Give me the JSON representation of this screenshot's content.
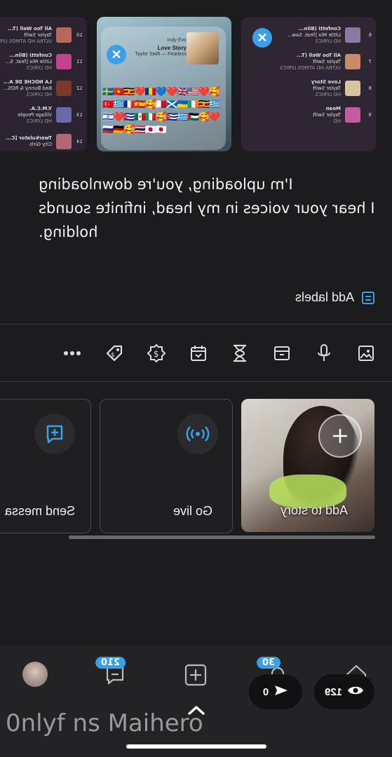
{
  "thumbnails": {
    "left_tracks": [
      {
        "num": "10",
        "title": "All Too Well (T...",
        "artist": "Taylor Swift",
        "tags": "ULTRA HD  ATMOS  LYRICS"
      },
      {
        "num": "11",
        "title": "Confetti (Blin...",
        "artist": "Little Mix [feat. S...",
        "tags": "HD  LYRICS"
      },
      {
        "num": "12",
        "title": "LA NOCHE DE A...",
        "artist": "Bad Bunny & ROS...",
        "tags": "HD  LYRICS"
      },
      {
        "num": "13",
        "title": "Y.M.C.A.",
        "artist": "Village People",
        "tags": "HD  LYRICS"
      },
      {
        "num": "14",
        "title": "Twerkulator [C...",
        "artist": "City Girls",
        "tags": ""
      }
    ],
    "middle": {
      "app": "Indy Evo",
      "song": "Love Story",
      "artist": "Taylor Swift — Fearless"
    },
    "right_tracks": [
      {
        "num": "6",
        "title": "Confetti (Blin...",
        "artist": "Little Mix [feat. Saw...",
        "tags": "HD  LYRICS"
      },
      {
        "num": "7",
        "title": "All Too Well (T...",
        "artist": "Taylor Swift",
        "tags": "ULTRA HD  ATMOS  LYRICS"
      },
      {
        "num": "8",
        "title": "Love Story",
        "artist": "Taylor Swift",
        "tags": "HD  LYRICS"
      },
      {
        "num": "9",
        "title": "Mean",
        "artist": "Taylor Swift",
        "tags": "HD"
      }
    ]
  },
  "lyrics": {
    "line1": "I'm uploading, you're downloading",
    "line2": "I hear your voices in my head, infinite sounds",
    "line3": "holding."
  },
  "labels": {
    "text": "Add labels"
  },
  "toolbar_icons": [
    "image-icon",
    "mic-icon",
    "archive-icon",
    "hourglass-icon",
    "calendar-icon",
    "badge-dollar-icon",
    "tag-icon",
    "more-icon"
  ],
  "cards": {
    "story": "Add to story",
    "live": "Go live",
    "message": "Send messa"
  },
  "nav": {
    "badge_notifications": "30",
    "badge_messages": "210",
    "views": "129",
    "shares": "0"
  },
  "watermark": "0nlyf ns Maihero",
  "colors": {
    "accent": "#3aa0e6",
    "background": "#1c1c1e"
  }
}
